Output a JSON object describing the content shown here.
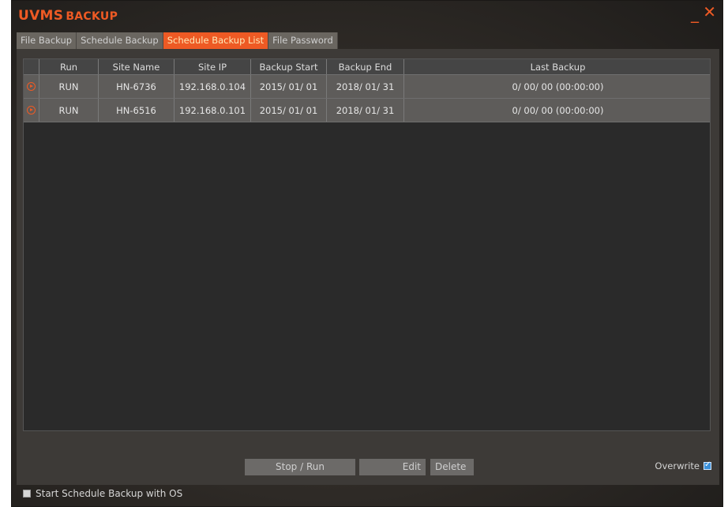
{
  "app": {
    "brand_main": "UVMS",
    "brand_sub": "BACKUP",
    "minimize_glyph": "_",
    "close_glyph": "✕"
  },
  "tabs": [
    {
      "label": "File Backup",
      "active": false
    },
    {
      "label": "Schedule Backup",
      "active": false
    },
    {
      "label": "Schedule Backup List",
      "active": true
    },
    {
      "label": "File Password",
      "active": false
    }
  ],
  "table": {
    "columns": [
      "Run",
      "Site Name",
      "Site IP",
      "Backup Start",
      "Backup End",
      "Last Backup"
    ],
    "rows": [
      {
        "icon": "run-circle-icon",
        "run": "RUN",
        "site_name": "HN-6736",
        "site_ip": "192.168.0.104",
        "backup_start": "2015/ 01/ 01",
        "backup_end": "2018/ 01/ 31",
        "last_backup": "0/ 00/ 00 (00:00:00)"
      },
      {
        "icon": "run-circle-icon",
        "run": "RUN",
        "site_name": "HN-6516",
        "site_ip": "192.168.0.101",
        "backup_start": "2015/ 01/ 01",
        "backup_end": "2018/ 01/ 31",
        "last_backup": "0/ 00/ 00 (00:00:00)"
      }
    ]
  },
  "buttons": {
    "stop_run": "Stop / Run",
    "edit": "Edit",
    "delete": "Delete"
  },
  "overwrite": {
    "label": "Overwrite",
    "checked": true
  },
  "start_with_os": {
    "label": "Start Schedule Backup with OS",
    "checked": false
  },
  "colors": {
    "accent": "#ee5a24",
    "panel": "#3d3a37",
    "grid_bg": "#2a2a2a",
    "row_bg": "#5e5c5a"
  }
}
